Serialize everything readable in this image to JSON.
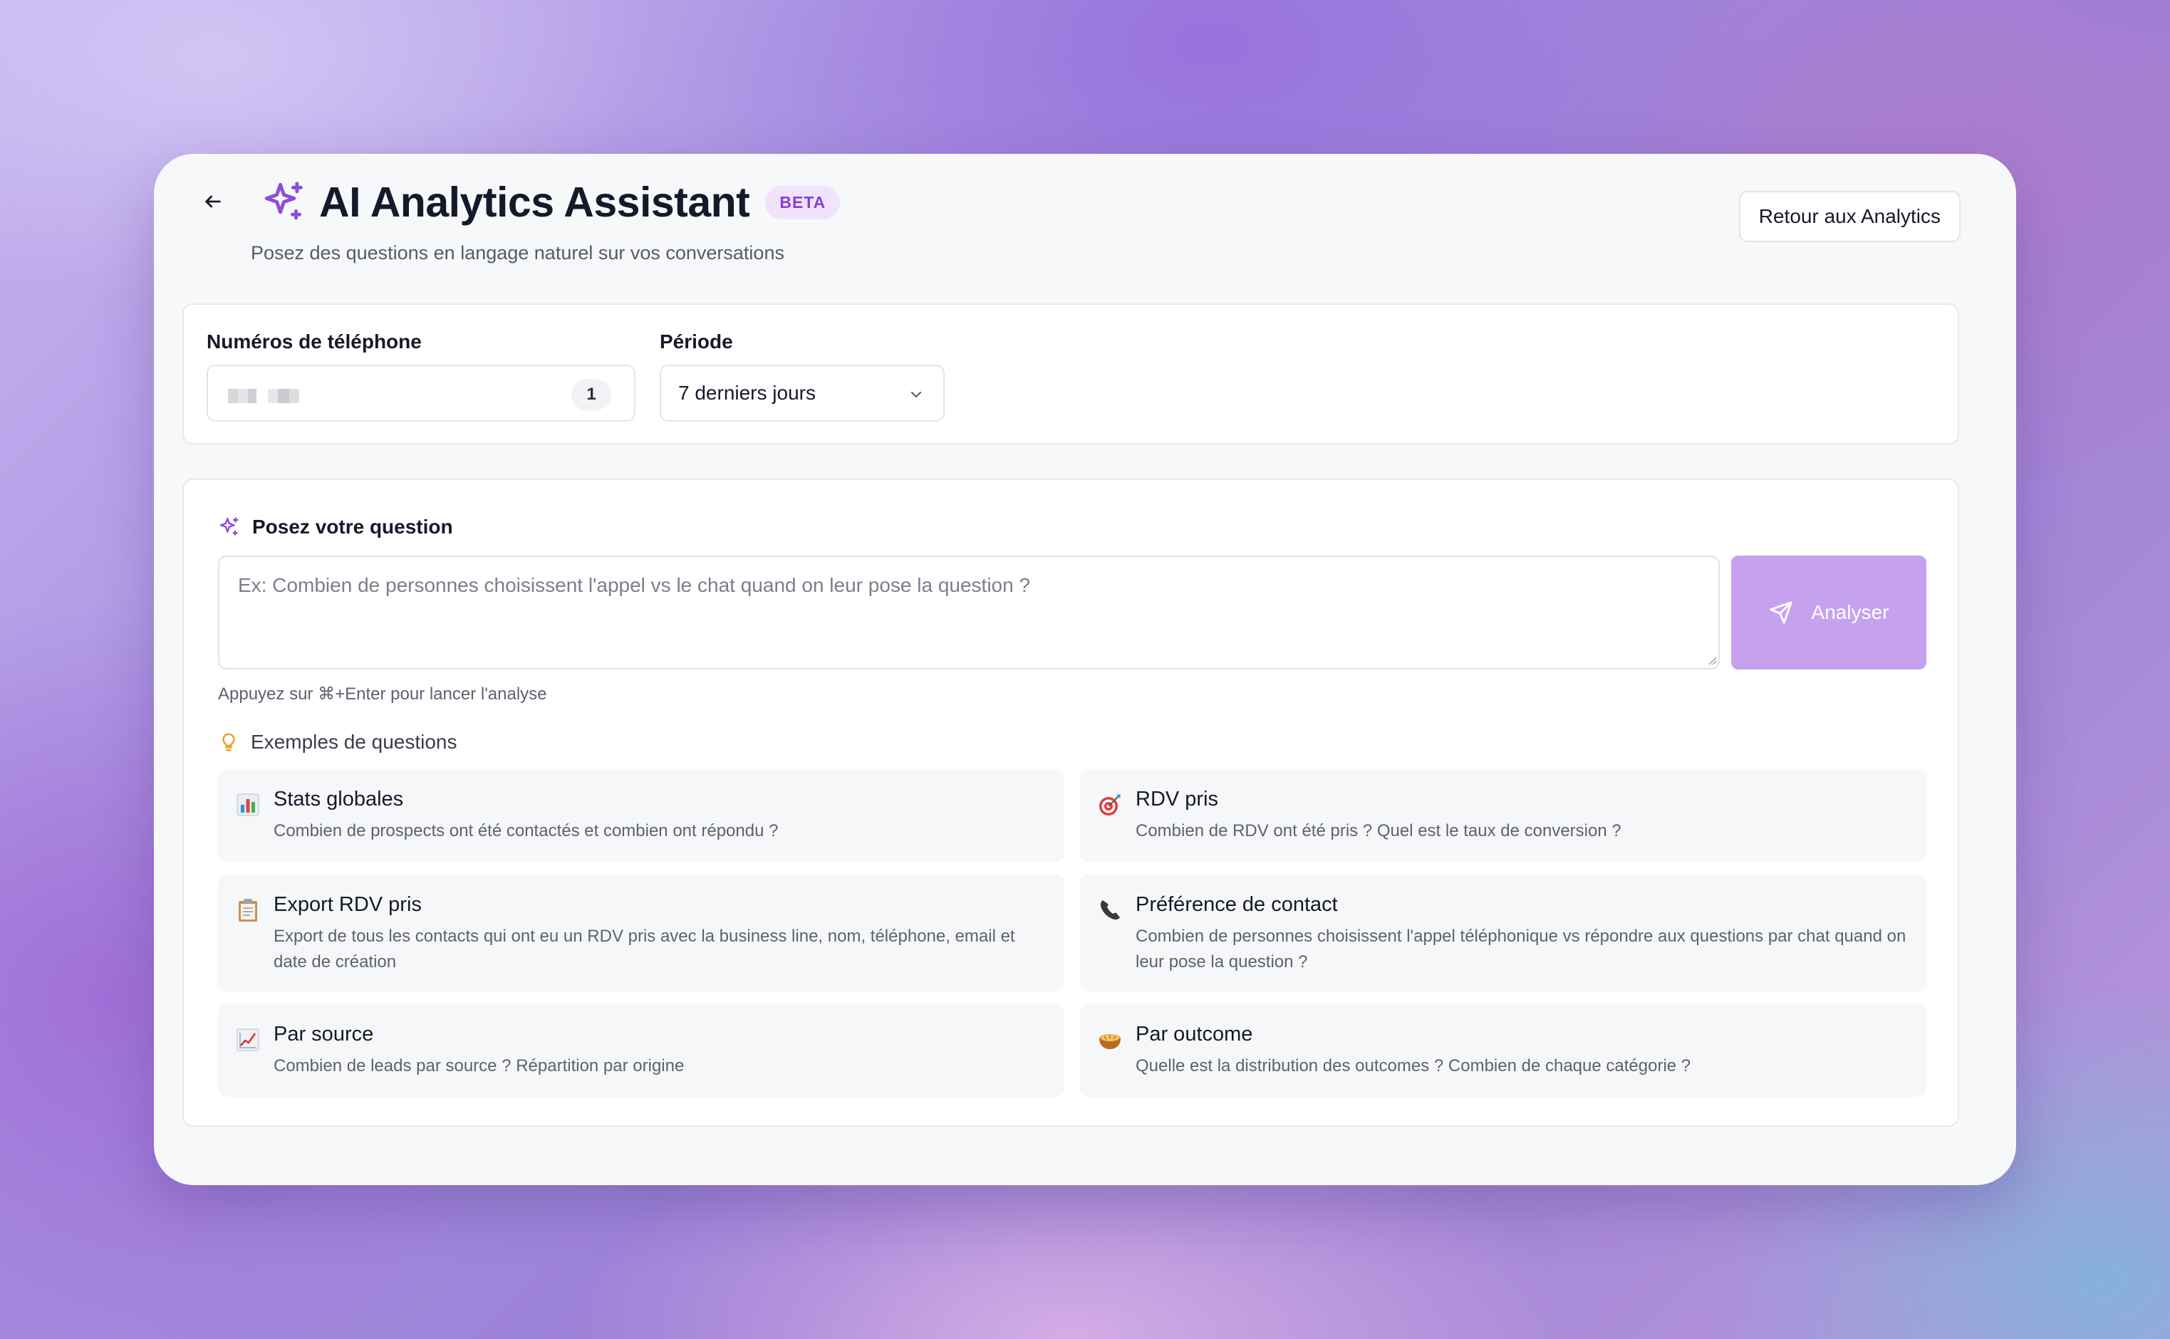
{
  "header": {
    "title": "AI Analytics Assistant",
    "badge": "BETA",
    "subtitle": "Posez des questions en langage naturel sur vos conversations",
    "back_button_label": "Retour aux Analytics"
  },
  "filters": {
    "phone_label": "Numéros de téléphone",
    "phone_count": "1",
    "period_label": "Période",
    "period_value": "7 derniers jours"
  },
  "ask": {
    "title": "Posez votre question",
    "placeholder": "Ex: Combien de personnes choisissent l'appel vs le chat quand on leur pose la question ?",
    "button_label": "Analyser",
    "hint": "Appuyez sur ⌘+Enter pour lancer l'analyse"
  },
  "examples": {
    "title": "Exemples de questions",
    "items": [
      {
        "icon": "bar-chart-icon",
        "title": "Stats globales",
        "desc": "Combien de prospects ont été contactés et combien ont répondu ?"
      },
      {
        "icon": "target-icon",
        "title": "RDV pris",
        "desc": "Combien de RDV ont été pris ? Quel est le taux de conversion ?"
      },
      {
        "icon": "clipboard-icon",
        "title": "Export RDV pris",
        "desc": "Export de tous les contacts qui ont eu un RDV pris avec la business line, nom, téléphone, email et date de création"
      },
      {
        "icon": "phone-icon",
        "title": "Préférence de contact",
        "desc": "Combien de personnes choisissent l'appel téléphonique vs répondre aux questions par chat quand on leur pose la question ?"
      },
      {
        "icon": "trend-chart-icon",
        "title": "Par source",
        "desc": "Combien de leads par source ? Répartition par origine"
      },
      {
        "icon": "pie-icon",
        "title": "Par outcome",
        "desc": "Quelle est la distribution des outcomes ? Combien de chaque catégorie ?"
      }
    ]
  },
  "colors": {
    "accent": "#8b4fd8",
    "button_disabled": "#c6a2ee",
    "badge_bg": "#efe4fb"
  }
}
